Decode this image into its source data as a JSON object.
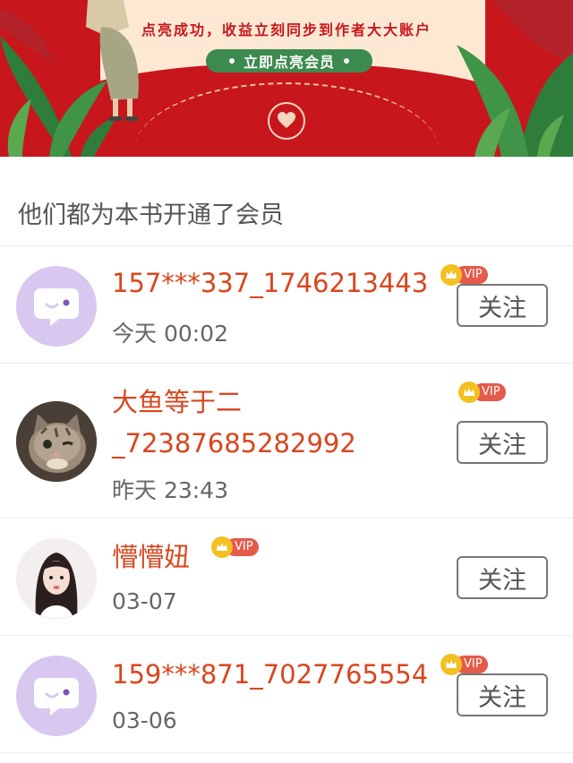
{
  "banner": {
    "notice": "点亮成功，收益立刻同步到作者大大账户",
    "cta_label": "立即点亮会员",
    "colors": {
      "red": "#c8161d",
      "cream": "#fde9d3",
      "green": "#3c8a4e"
    }
  },
  "section_title": "他们都为本书开通了会员",
  "vip_label": "VIP",
  "follow_label": "关注",
  "members": [
    {
      "name": "157***337_1746213443",
      "time": "今天 00:02",
      "avatar": "purple-placeholder"
    },
    {
      "name": "大鱼等于二_72387685282992",
      "name_line1": "大鱼等于二",
      "name_line2": "_72387685282992",
      "time": "昨天 23:43",
      "avatar": "cat-photo"
    },
    {
      "name": "懵懵妞",
      "time": "03-07",
      "avatar": "girl-photo"
    },
    {
      "name": "159***871_7027765554",
      "time": "03-06",
      "avatar": "purple-placeholder"
    }
  ]
}
